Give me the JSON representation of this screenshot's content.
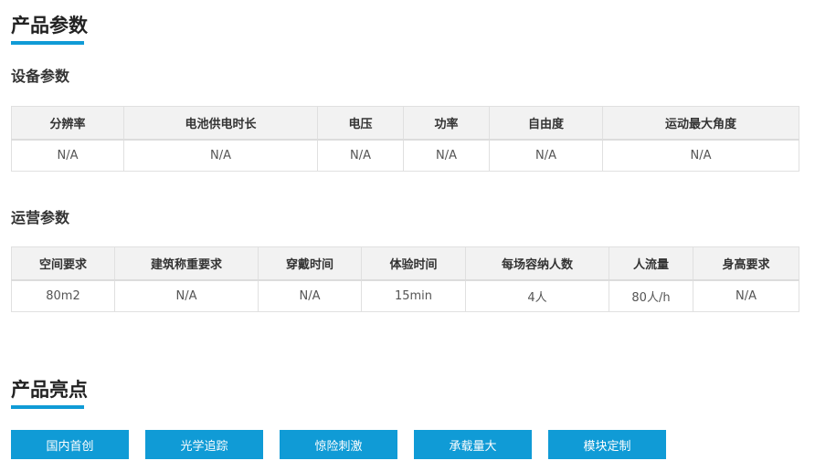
{
  "product_params": {
    "title": "产品参数"
  },
  "device_params": {
    "title": "设备参数",
    "headers": [
      "分辨率",
      "电池供电时长",
      "电压",
      "功率",
      "自由度",
      "运动最大角度"
    ],
    "values": [
      "N/A",
      "N/A",
      "N/A",
      "N/A",
      "N/A",
      "N/A"
    ]
  },
  "operation_params": {
    "title": "运营参数",
    "headers": [
      "空间要求",
      "建筑称重要求",
      "穿戴时间",
      "体验时间",
      "每场容纳人数",
      "人流量",
      "身高要求"
    ],
    "values": [
      "80m2",
      "N/A",
      "N/A",
      "15min",
      "4人",
      "80人/h",
      "N/A"
    ]
  },
  "highlights": {
    "title": "产品亮点",
    "items": [
      "国内首创",
      "光学追踪",
      "惊险刺激",
      "承载量大",
      "模块定制"
    ]
  },
  "colors": {
    "accent": "#109bd6",
    "header_bg": "#f2f2f2",
    "border": "#e0e0e0"
  }
}
